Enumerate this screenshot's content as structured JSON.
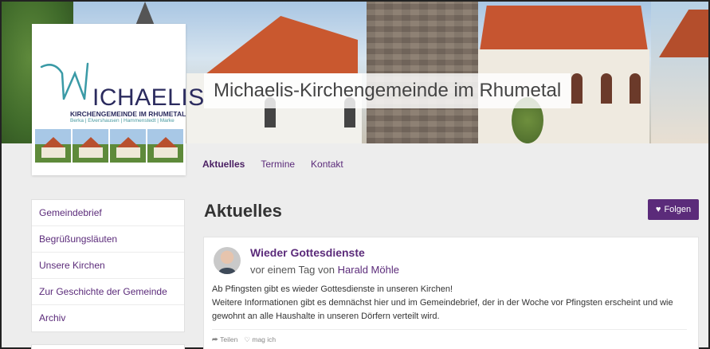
{
  "site": {
    "title": "Michaelis-Kirchengemeinde im Rhumetal"
  },
  "logo": {
    "name": "ICHAELIS",
    "subtitle": "KIRCHENGEMEINDE IM RHUMETAL",
    "places": "Berka | Elvershausen | Hammenstedt | Marke"
  },
  "nav": {
    "items": [
      {
        "label": "Aktuelles",
        "active": true
      },
      {
        "label": "Termine",
        "active": false
      },
      {
        "label": "Kontakt",
        "active": false
      }
    ]
  },
  "sidebar": {
    "items": [
      {
        "label": "Gemeindebrief"
      },
      {
        "label": "Begrüßungsläuten"
      },
      {
        "label": "Unsere Kirchen"
      },
      {
        "label": "Zur Geschichte der Gemeinde"
      },
      {
        "label": "Archiv"
      }
    ]
  },
  "main": {
    "heading": "Aktuelles",
    "follow_label": "Folgen"
  },
  "post": {
    "title": "Wieder Gottesdienste",
    "meta_prefix": "vor einem Tag von",
    "author": "Harald Möhle",
    "body_line1": "Ab Pfingsten gibt es wieder Gottesdienste in unseren Kirchen!",
    "body_line2": "Weitere Informationen gibt es demnächst hier und im Gemeindebrief, der in der Woche vor Pfingsten erscheint und wie gewohnt an alle Haushalte in unseren Dörfern verteilt wird.",
    "share_label": "Teilen",
    "like_label": "mag ich"
  },
  "colors": {
    "accent": "#5b2b7a",
    "background": "#ededed"
  }
}
